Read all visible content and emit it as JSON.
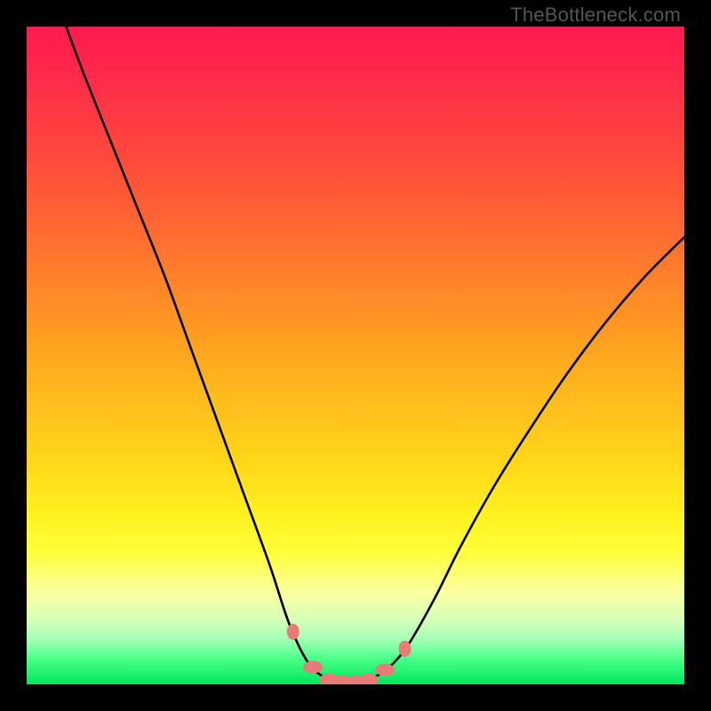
{
  "watermark": "TheBottleneck.com",
  "chart_data": {
    "type": "line",
    "title": "",
    "xlabel": "",
    "ylabel": "",
    "xlim": [
      0,
      100
    ],
    "ylim": [
      0,
      100
    ],
    "background_gradient": {
      "top_color": "#ff1a4f",
      "bottom_color": "#00e65c",
      "description": "red (top, high bottleneck) to green (bottom, no bottleneck)"
    },
    "curve_description": "Asymmetric V-shaped bottleneck curve; left branch starts at top-left and descends steeply to a flat minimum near x≈48, right branch rises more gradually toward the upper right.",
    "curve_points_xy_0to100": [
      [
        6,
        100
      ],
      [
        9,
        92
      ],
      [
        13,
        82
      ],
      [
        17,
        72
      ],
      [
        21,
        62
      ],
      [
        25,
        51
      ],
      [
        29,
        40
      ],
      [
        33,
        29
      ],
      [
        37,
        18
      ],
      [
        40,
        9
      ],
      [
        43,
        3
      ],
      [
        46,
        0.7
      ],
      [
        48,
        0.4
      ],
      [
        50,
        0.4
      ],
      [
        52,
        0.7
      ],
      [
        55,
        2.5
      ],
      [
        58,
        6
      ],
      [
        62,
        13
      ],
      [
        66,
        21
      ],
      [
        71,
        30
      ],
      [
        76,
        38
      ],
      [
        82,
        47
      ],
      [
        88,
        55
      ],
      [
        94,
        62
      ],
      [
        100,
        68
      ]
    ],
    "plateau_markers_x_0to100": [
      40.5,
      43.5,
      46,
      48,
      50,
      52,
      54.5,
      57.5
    ],
    "markers_description": "Salmon-colored lozenge markers clustered at the curve minimum, highlighting the no-bottleneck region."
  }
}
